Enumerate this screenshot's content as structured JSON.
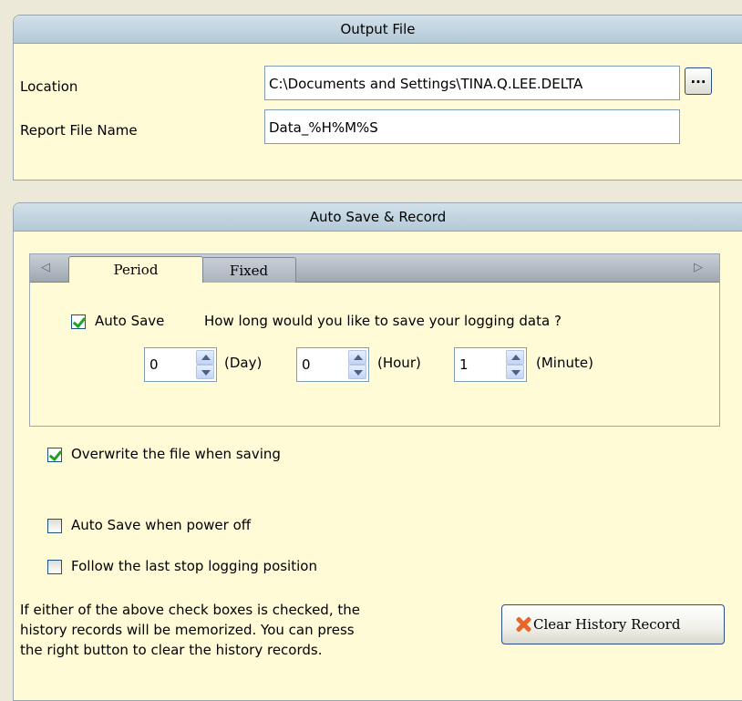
{
  "output_file": {
    "header": "Output File",
    "location_label": "Location",
    "location_value": "C:\\Documents and Settings\\TINA.Q.LEE.DELTA",
    "browse_label": "...",
    "report_label": "Report File Name",
    "report_value": "Data_%H%M%S"
  },
  "auto_save": {
    "header": "Auto Save & Record",
    "tabs": [
      "Period",
      "Fixed"
    ],
    "active_tab": "Period",
    "autosave_label": "Auto Save",
    "autosave_checked": true,
    "question": "How long would you like to save your logging data ?",
    "day_value": "0",
    "day_unit": "(Day)",
    "hour_value": "0",
    "hour_unit": "(Hour)",
    "minute_value": "1",
    "minute_unit": "(Minute)",
    "overwrite_label": "Overwrite the file when saving",
    "overwrite_checked": true,
    "poweroff_label": "Auto Save when power off",
    "poweroff_checked": false,
    "follow_label": "Follow the last stop logging position",
    "follow_checked": false,
    "info_lines": [
      "If either of the above check boxes is checked, the",
      "history records will be memorized. You can press",
      "the right button to clear the history records."
    ],
    "clear_button": "Clear History Record"
  }
}
